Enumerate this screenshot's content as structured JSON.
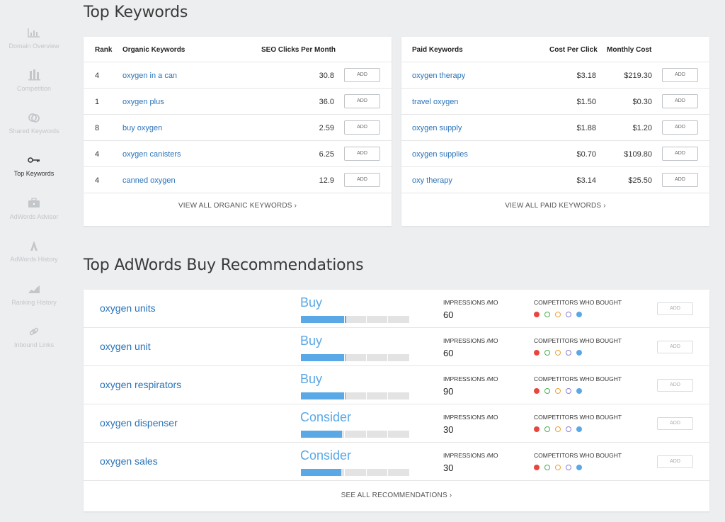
{
  "sidebar": {
    "items": [
      {
        "label": "Domain Overview",
        "icon": "bar-chart-icon"
      },
      {
        "label": "Competition",
        "icon": "competition-icon"
      },
      {
        "label": "Shared Keywords",
        "icon": "shared-circles-icon"
      },
      {
        "label": "Top Keywords",
        "icon": "key-icon",
        "active": true
      },
      {
        "label": "AdWords Advisor",
        "icon": "briefcase-icon"
      },
      {
        "label": "AdWords History",
        "icon": "adwords-logo-icon"
      },
      {
        "label": "Ranking History",
        "icon": "area-chart-icon"
      },
      {
        "label": "Inbound Links",
        "icon": "link-icon"
      }
    ]
  },
  "top_keywords": {
    "title": "Top Keywords",
    "organic": {
      "headers": {
        "rank": "Rank",
        "keyword": "Organic Keywords",
        "clicks": "SEO Clicks Per Month"
      },
      "rows": [
        {
          "rank": "4",
          "keyword": "oxygen in a can",
          "clicks": "30.8",
          "add": "ADD"
        },
        {
          "rank": "1",
          "keyword": "oxygen plus",
          "clicks": "36.0",
          "add": "ADD"
        },
        {
          "rank": "8",
          "keyword": "buy oxygen",
          "clicks": "2.59",
          "add": "ADD"
        },
        {
          "rank": "4",
          "keyword": "oxygen canisters",
          "clicks": "6.25",
          "add": "ADD"
        },
        {
          "rank": "4",
          "keyword": "canned oxygen",
          "clicks": "12.9",
          "add": "ADD"
        }
      ],
      "view_all": "VIEW ALL ORGANIC KEYWORDS ›"
    },
    "paid": {
      "headers": {
        "keyword": "Paid Keywords",
        "cpc": "Cost Per Click",
        "monthly": "Monthly Cost"
      },
      "rows": [
        {
          "keyword": "oxygen therapy",
          "cpc": "$3.18",
          "monthly": "$219.30",
          "add": "ADD"
        },
        {
          "keyword": "travel oxygen",
          "cpc": "$1.50",
          "monthly": "$0.30",
          "add": "ADD"
        },
        {
          "keyword": "oxygen supply",
          "cpc": "$1.88",
          "monthly": "$1.20",
          "add": "ADD"
        },
        {
          "keyword": "oxygen supplies",
          "cpc": "$0.70",
          "monthly": "$109.80",
          "add": "ADD"
        },
        {
          "keyword": "oxy therapy",
          "cpc": "$3.14",
          "monthly": "$25.50",
          "add": "ADD"
        }
      ],
      "view_all": "VIEW ALL PAID KEYWORDS ›"
    }
  },
  "recommendations": {
    "title": "Top AdWords Buy Recommendations",
    "impressions_label": "IMPRESSIONS /MO",
    "competitors_label": "COMPETITORS WHO BOUGHT",
    "competitor_colors": [
      {
        "color": "#e8453c",
        "filled": true
      },
      {
        "color": "#4caf50",
        "filled": false
      },
      {
        "color": "#f0a030",
        "filled": false
      },
      {
        "color": "#8a7fd0",
        "filled": false
      },
      {
        "color": "#5aa8e6",
        "filled": true
      }
    ],
    "rows": [
      {
        "keyword": "oxygen units",
        "verdict": "Buy",
        "strength": 0.42,
        "impressions": "60",
        "add": "ADD"
      },
      {
        "keyword": "oxygen unit",
        "verdict": "Buy",
        "strength": 0.41,
        "impressions": "60",
        "add": "ADD"
      },
      {
        "keyword": "oxygen respirators",
        "verdict": "Buy",
        "strength": 0.41,
        "impressions": "90",
        "add": "ADD"
      },
      {
        "keyword": "oxygen dispenser",
        "verdict": "Consider",
        "strength": 0.38,
        "impressions": "30",
        "add": "ADD"
      },
      {
        "keyword": "oxygen sales",
        "verdict": "Consider",
        "strength": 0.37,
        "impressions": "30",
        "add": "ADD"
      }
    ],
    "see_all": "SEE ALL RECOMMENDATIONS ›"
  },
  "colors": {
    "accent": "#2a73b8",
    "bar": "#5aa8e6",
    "background": "#eceef0"
  }
}
